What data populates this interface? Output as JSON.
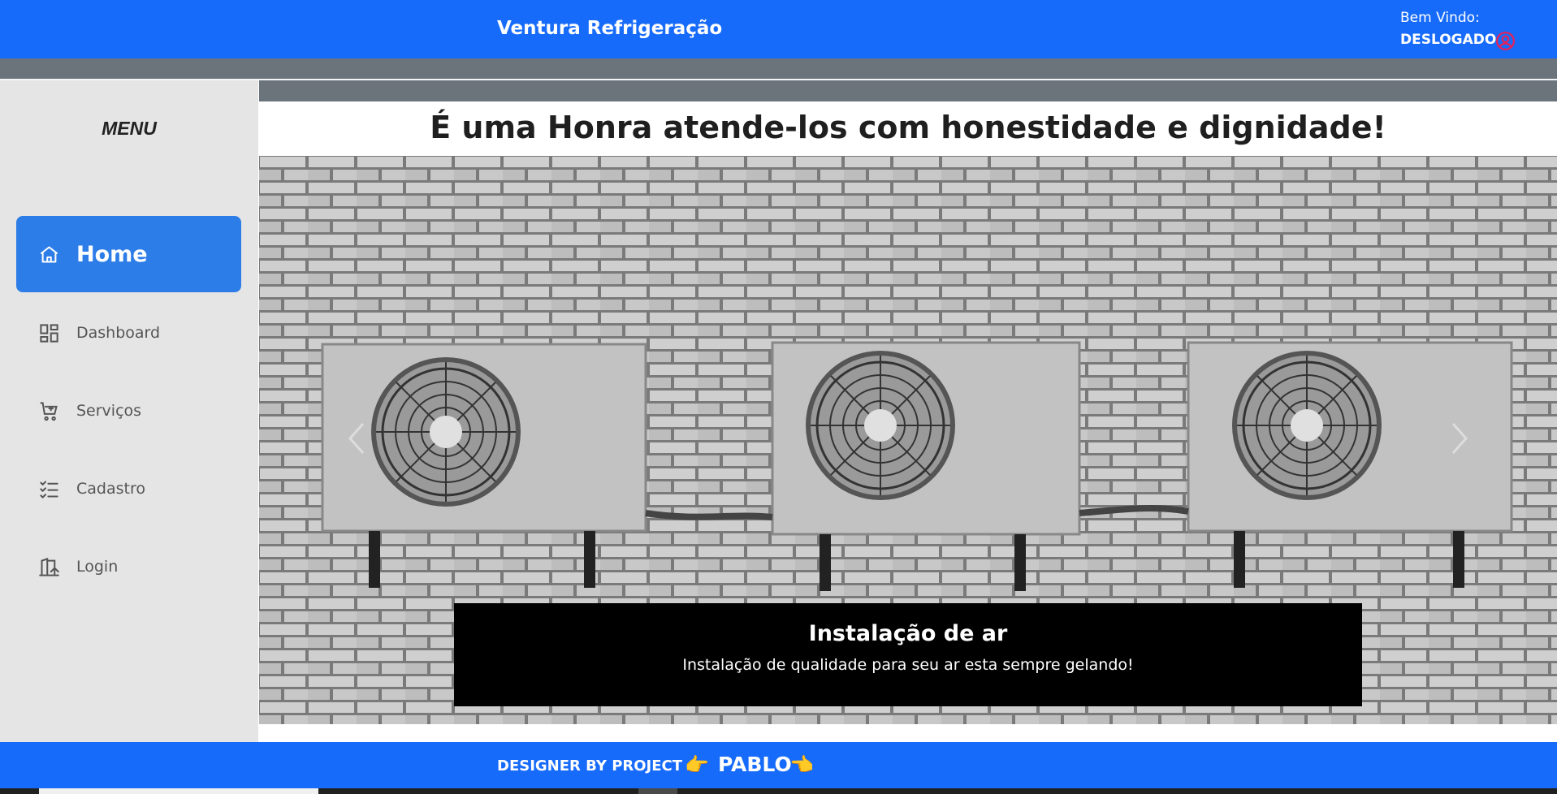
{
  "header": {
    "brand": "Ventura Refrigeração",
    "welcome": "Bem Vindo:",
    "status": "DESLOGADO"
  },
  "sidebar": {
    "title": "MENU",
    "items": [
      {
        "label": "Home",
        "icon": "home-icon",
        "active": true
      },
      {
        "label": "Dashboard",
        "icon": "dashboard-icon"
      },
      {
        "label": "Serviços",
        "icon": "cart-icon"
      },
      {
        "label": "Cadastro",
        "icon": "checklist-icon"
      },
      {
        "label": "Login",
        "icon": "login-icon"
      }
    ]
  },
  "main": {
    "headline": "É uma Honra atende-los com honestidade e dignidade!",
    "carousel": {
      "caption_title": "Instalação de ar",
      "caption_text": "Instalação de qualidade para seu ar esta sempre gelando!"
    }
  },
  "footer": {
    "designer": "DESIGNER BY PROJECT",
    "name": "PABLO"
  },
  "colors": {
    "primary": "#176bfa",
    "active_item": "#2c7de8",
    "grey_bar": "#6b737b",
    "sidebar_bg": "#e5e5e5",
    "user_icon": "#e0245e"
  }
}
